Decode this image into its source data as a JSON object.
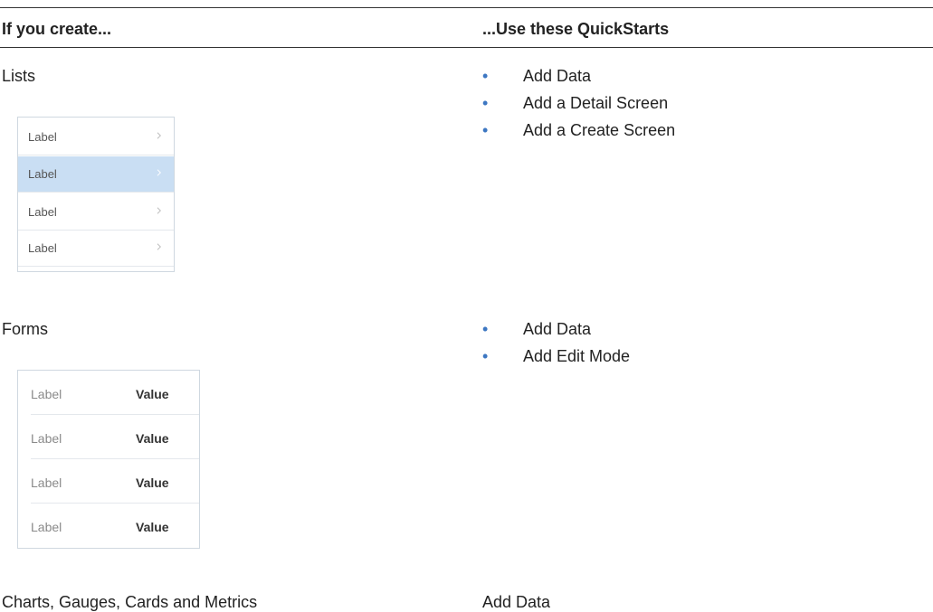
{
  "header": {
    "left": "If you create...",
    "right": "...Use these QuickStarts"
  },
  "rows": [
    {
      "create": "Lists",
      "quickstarts": [
        "Add Data",
        "Add a Detail Screen",
        "Add a Create Screen"
      ],
      "thumbnail": {
        "items": [
          {
            "label": "Label",
            "selected": false
          },
          {
            "label": "Label",
            "selected": true
          },
          {
            "label": "Label",
            "selected": false
          },
          {
            "label": "Label",
            "selected": false
          }
        ]
      }
    },
    {
      "create": "Forms",
      "quickstarts": [
        "Add Data",
        "Add Edit Mode"
      ],
      "thumbnail": {
        "items": [
          {
            "label": "Label",
            "value": "Value"
          },
          {
            "label": "Label",
            "value": "Value"
          },
          {
            "label": "Label",
            "value": "Value"
          },
          {
            "label": "Label",
            "value": "Value"
          }
        ]
      }
    },
    {
      "create": "Charts, Gauges, Cards and Metrics",
      "quickstart_text": "Add Data"
    }
  ],
  "colors": {
    "bullet": "#3d77c2",
    "selected_row": "#c9def3",
    "rule": "#333333"
  },
  "icons": {
    "list_chevron": "chevron-right-icon"
  }
}
